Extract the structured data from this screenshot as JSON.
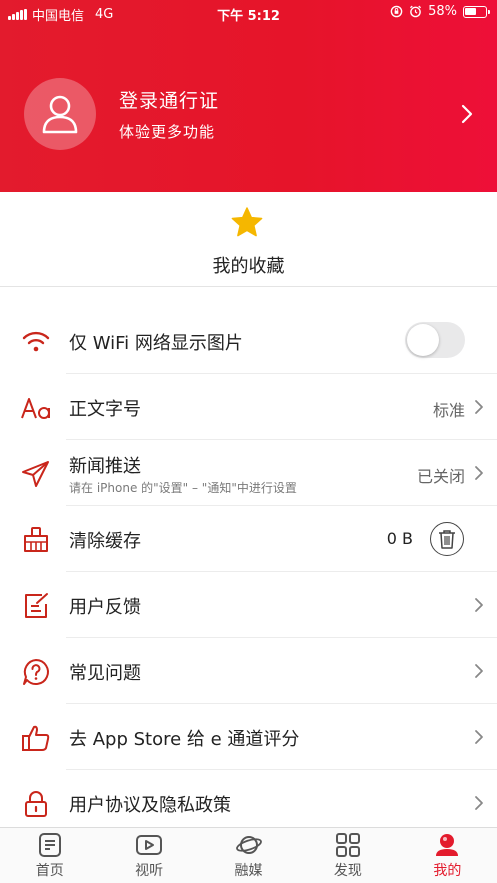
{
  "status_bar": {
    "carrier": "中国电信",
    "network": "4G",
    "time": "下午 5:12",
    "battery_percent": "58%",
    "battery_level": 0.58
  },
  "profile": {
    "login_title": "登录通行证",
    "login_subtitle": "体验更多功能"
  },
  "favorites": {
    "label": "我的收藏"
  },
  "settings": {
    "wifi_images": {
      "label": "仅 WiFi 网络显示图片",
      "enabled": false
    },
    "font_size": {
      "label": "正文字号",
      "value": "标准"
    },
    "push": {
      "label": "新闻推送",
      "subtitle": "请在 iPhone 的\"设置\" – \"通知\"中进行设置",
      "value": "已关闭"
    },
    "cache": {
      "label": "清除缓存",
      "value": "0 B"
    },
    "feedback": {
      "label": "用户反馈"
    },
    "faq": {
      "label": "常见问题"
    },
    "rate": {
      "label": "去 App Store 给 e 通道评分"
    },
    "privacy": {
      "label": "用户协议及隐私政策"
    }
  },
  "tabbar": {
    "items": [
      {
        "label": "首页",
        "icon": "home-icon"
      },
      {
        "label": "视听",
        "icon": "video-icon"
      },
      {
        "label": "融媒",
        "icon": "planet-icon"
      },
      {
        "label": "发现",
        "icon": "grid-icon"
      },
      {
        "label": "我的",
        "icon": "profile-icon"
      }
    ],
    "active_index": 4
  },
  "colors": {
    "brand_red": "#e31b2d",
    "icon_red": "#c9261b",
    "star_yellow": "#f5b700"
  }
}
